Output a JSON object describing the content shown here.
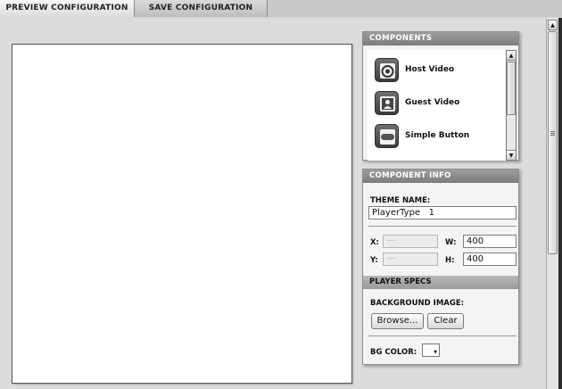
{
  "tabs": [
    {
      "label": "PREVIEW CONFIGURATION",
      "active": true
    },
    {
      "label": "SAVE CONFIGURATION",
      "active": false
    }
  ],
  "components_panel": {
    "title": "COMPONENTS",
    "items": [
      {
        "label": "Host Video",
        "icon": "webcam-icon"
      },
      {
        "label": "Guest Video",
        "icon": "person-icon"
      },
      {
        "label": "Simple Button",
        "icon": "button-icon"
      }
    ]
  },
  "component_info": {
    "title": "COMPONENT INFO",
    "theme_name_label": "THEME NAME:",
    "theme_name_value": "PlayerType   1",
    "x_label": "X:",
    "x_value": "----",
    "y_label": "Y:",
    "y_value": "----",
    "w_label": "W:",
    "w_value": "400",
    "h_label": "H:",
    "h_value": "400"
  },
  "player_specs": {
    "title": "PLAYER SPECS",
    "bg_image_label": "BACKGROUND IMAGE:",
    "browse_label": "Browse...",
    "clear_label": "Clear",
    "bg_color_label": "BG COLOR:",
    "bg_color_value": "#ffffff"
  },
  "colors": {
    "panel_header": "#8a8a8a",
    "background": "#dcdcdc",
    "canvas": "#ffffff"
  }
}
